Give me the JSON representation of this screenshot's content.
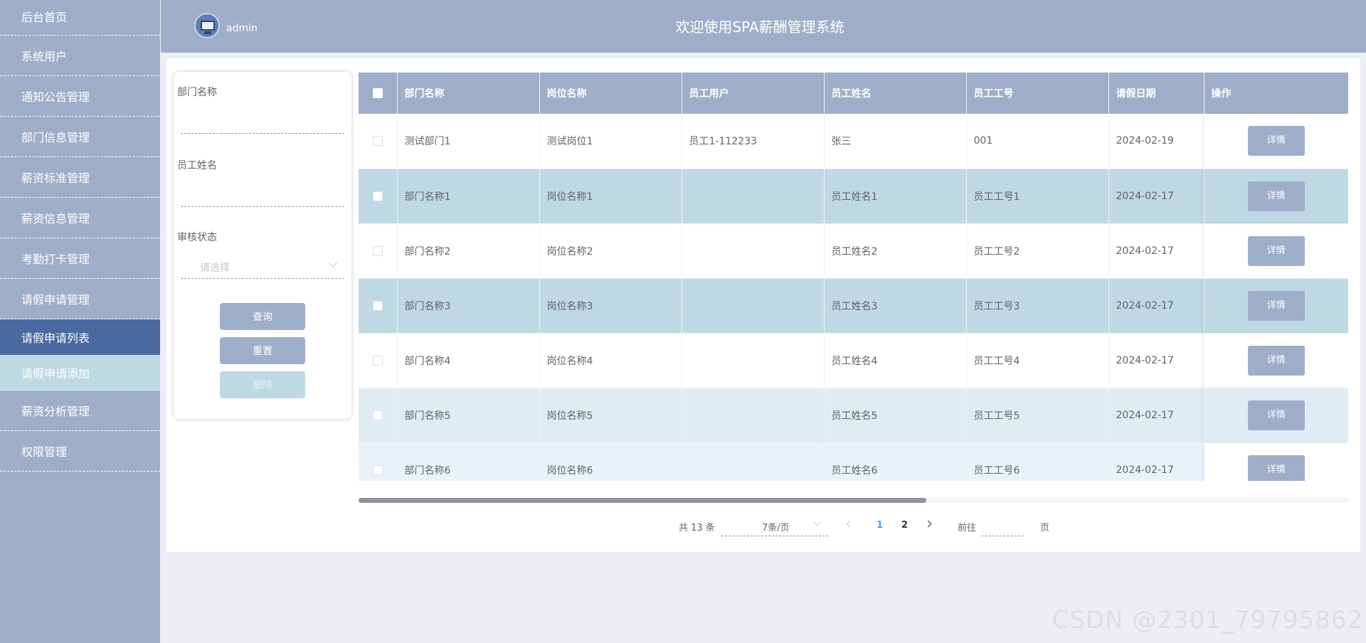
{
  "header": {
    "username": "admin",
    "title": "欢迎使用SPA薪酬管理系统"
  },
  "sidebar": {
    "items": [
      {
        "label": "后台首页"
      },
      {
        "label": "系统用户"
      },
      {
        "label": "通知公告管理"
      },
      {
        "label": "部门信息管理"
      },
      {
        "label": "薪资标准管理"
      },
      {
        "label": "薪资信息管理"
      },
      {
        "label": "考勤打卡管理"
      },
      {
        "label": "请假申请管理"
      },
      {
        "label": "请假申请列表"
      },
      {
        "label": "请假申请添加"
      },
      {
        "label": "薪资分析管理"
      },
      {
        "label": "权限管理"
      }
    ]
  },
  "search": {
    "dept_label": "部门名称",
    "emp_label": "员工姓名",
    "status_label": "审核状态",
    "status_placeholder": "请选择",
    "query_btn": "查询",
    "reset_btn": "重置",
    "delete_btn": "删除"
  },
  "table": {
    "headers": [
      "部门名称",
      "岗位名称",
      "员工用户",
      "员工姓名",
      "员工工号",
      "请假日期",
      "操作"
    ],
    "detail_label": "详情",
    "rows": [
      {
        "dept": "测试部门1",
        "post": "测试岗位1",
        "user": "员工1-112233",
        "name": "张三",
        "no": "001",
        "date": "2024-02-19"
      },
      {
        "dept": "部门名称1",
        "post": "岗位名称1",
        "user": "",
        "name": "员工姓名1",
        "no": "员工工号1",
        "date": "2024-02-17"
      },
      {
        "dept": "部门名称2",
        "post": "岗位名称2",
        "user": "",
        "name": "员工姓名2",
        "no": "员工工号2",
        "date": "2024-02-17"
      },
      {
        "dept": "部门名称3",
        "post": "岗位名称3",
        "user": "",
        "name": "员工姓名3",
        "no": "员工工号3",
        "date": "2024-02-17"
      },
      {
        "dept": "部门名称4",
        "post": "岗位名称4",
        "user": "",
        "name": "员工姓名4",
        "no": "员工工号4",
        "date": "2024-02-17"
      },
      {
        "dept": "部门名称5",
        "post": "岗位名称5",
        "user": "",
        "name": "员工姓名5",
        "no": "员工工号5",
        "date": "2024-02-17"
      },
      {
        "dept": "部门名称6",
        "post": "岗位名称6",
        "user": "",
        "name": "员工姓名6",
        "no": "员工工号6",
        "date": "2024-02-17"
      }
    ]
  },
  "pagination": {
    "total": "共 13 条",
    "page_size": "7条/页",
    "current": "1",
    "next_page": "2",
    "goto": "前往",
    "page_suffix": "页"
  },
  "watermark": "CSDN @2301_79795862"
}
